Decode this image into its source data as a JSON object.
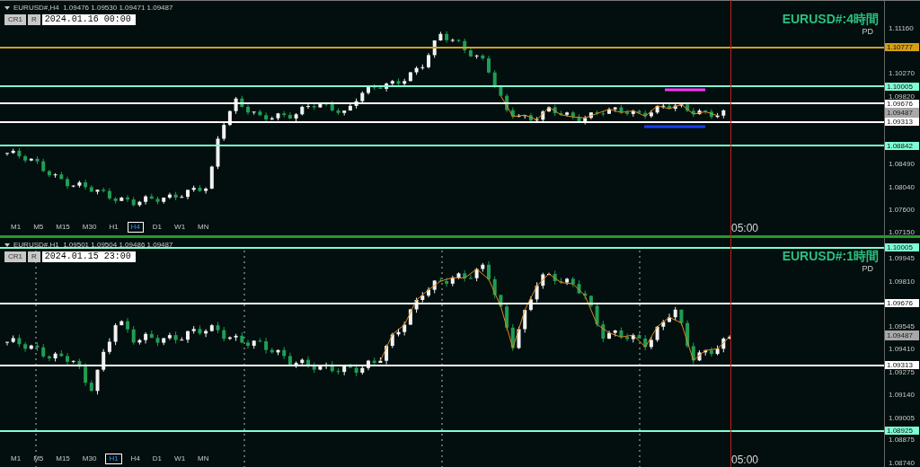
{
  "panes": [
    {
      "header": "EURUSD#,H4  1.09476 1.09530 1.09471 1.09487",
      "buttons": [
        "CR1",
        "R"
      ],
      "datetime": "2024.01.16 00:00",
      "title": "EURUSD#:4時間",
      "subtitle": "PD",
      "axis_ticks": [
        "1.11160",
        "1.10270",
        "1.09820",
        "1.08490",
        "1.08040",
        "1.07600",
        "1.07150"
      ],
      "levels": [
        {
          "tag": "1.10777",
          "color": "#d4a017"
        },
        {
          "tag": "1.10005",
          "color": "#7fffd4"
        },
        {
          "tag": "1.09676",
          "color": "#ffffff"
        },
        {
          "tag": "1.09313",
          "color": "#ffffff"
        },
        {
          "tag": "1.08842",
          "color": "#7fffd4"
        }
      ],
      "current_price": "1.09487",
      "time_label": "05:00",
      "timeframes": [
        {
          "label": "M1",
          "selected": false
        },
        {
          "label": "M5",
          "selected": false
        },
        {
          "label": "M15",
          "selected": false
        },
        {
          "label": "M30",
          "selected": false
        },
        {
          "label": "H1",
          "selected": false
        },
        {
          "label": "H4",
          "selected": true
        },
        {
          "label": "D1",
          "selected": false
        },
        {
          "label": "W1",
          "selected": false
        },
        {
          "label": "MN",
          "selected": false
        }
      ]
    },
    {
      "header": "EURUSD#,H1  1.09501 1.09504 1.09486 1.09487",
      "buttons": [
        "CR1",
        "R"
      ],
      "datetime": "2024.01.15 23:00",
      "title": "EURUSD#:1時間",
      "subtitle": "PD",
      "axis_ticks": [
        "1.09945",
        "1.09810",
        "1.09545",
        "1.09410",
        "1.09275",
        "1.09140",
        "1.09005",
        "1.08875",
        "1.08740"
      ],
      "levels": [
        {
          "tag": "1.10005",
          "color": "#7fffd4"
        },
        {
          "tag": "1.09676",
          "color": "#ffffff"
        },
        {
          "tag": "1.09313",
          "color": "#ffffff"
        },
        {
          "tag": "1.08925",
          "color": "#7fffd4"
        }
      ],
      "current_price": "1.09487",
      "time_label": "05:00",
      "timeframes": [
        {
          "label": "M1",
          "selected": false
        },
        {
          "label": "M5",
          "selected": false
        },
        {
          "label": "M15",
          "selected": false
        },
        {
          "label": "M30",
          "selected": false
        },
        {
          "label": "H1",
          "selected": true
        },
        {
          "label": "H4",
          "selected": false
        },
        {
          "label": "D1",
          "selected": false
        },
        {
          "label": "W1",
          "selected": false
        },
        {
          "label": "MN",
          "selected": false
        }
      ]
    }
  ]
}
